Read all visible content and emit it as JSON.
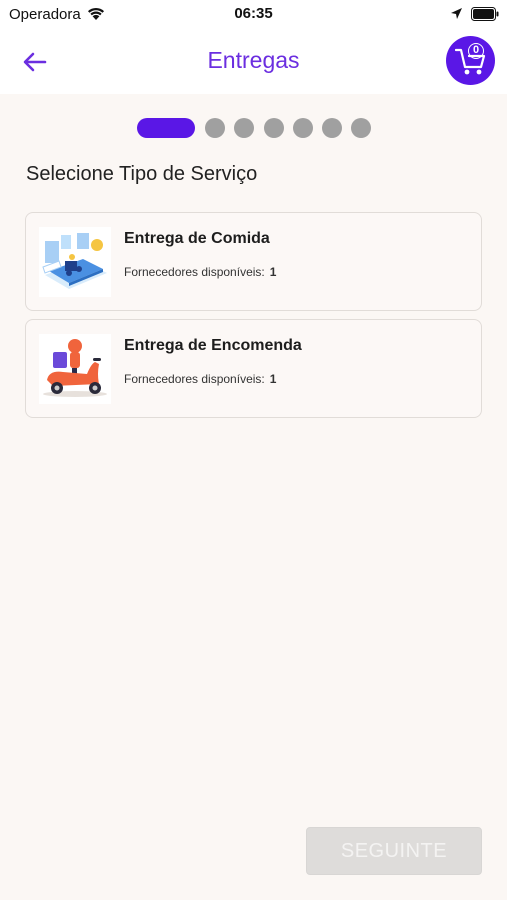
{
  "status": {
    "carrier": "Operadora",
    "time": "06:35"
  },
  "nav": {
    "title": "Entregas",
    "cart_count": "0"
  },
  "stepper": {
    "total_steps": 7,
    "current_step": 1
  },
  "section_title": "Selecione Tipo de Serviço",
  "services": [
    {
      "title": "Entrega de Comida",
      "providers_label": "Fornecedores disponíveis:",
      "providers_count": "1",
      "icon": "food-delivery-illustration"
    },
    {
      "title": "Entrega de Encomenda",
      "providers_label": "Fornecedores disponíveis:",
      "providers_count": "1",
      "icon": "scooter-courier-illustration"
    }
  ],
  "footer": {
    "next_label": "SEGUINTE",
    "next_enabled": false
  },
  "colors": {
    "accent": "#5a17e6",
    "title": "#6b2ee0",
    "disabled_button": "#dedcda",
    "background": "#fbf7f4"
  }
}
